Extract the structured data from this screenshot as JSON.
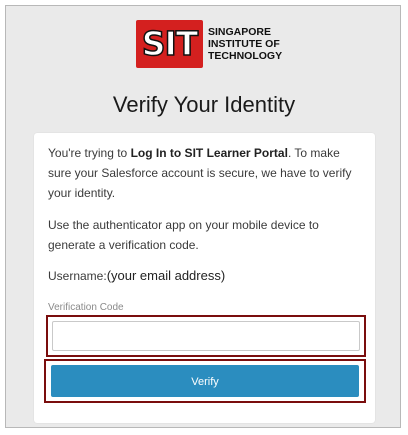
{
  "logo": {
    "mark": "SIT",
    "line1": "SINGAPORE",
    "line2": "INSTITUTE OF",
    "line3": "TECHNOLOGY"
  },
  "title": "Verify Your Identity",
  "message": {
    "prefix": "You're trying to ",
    "app_name": "Log In to SIT Learner Portal",
    "suffix": ". To make sure your Salesforce account is secure, we have to verify your identity."
  },
  "instruction": "Use the authenticator app on your mobile device to generate a verification code.",
  "username": {
    "label": "Username:",
    "value": "(your email address)"
  },
  "verification_code": {
    "label": "Verification Code",
    "value": ""
  },
  "verify_button": {
    "label": "Verify"
  },
  "colors": {
    "button": "#2b8dbf",
    "highlight_border": "#7a0d0d",
    "logo_red": "#d4201f",
    "background": "#eaeaea"
  }
}
